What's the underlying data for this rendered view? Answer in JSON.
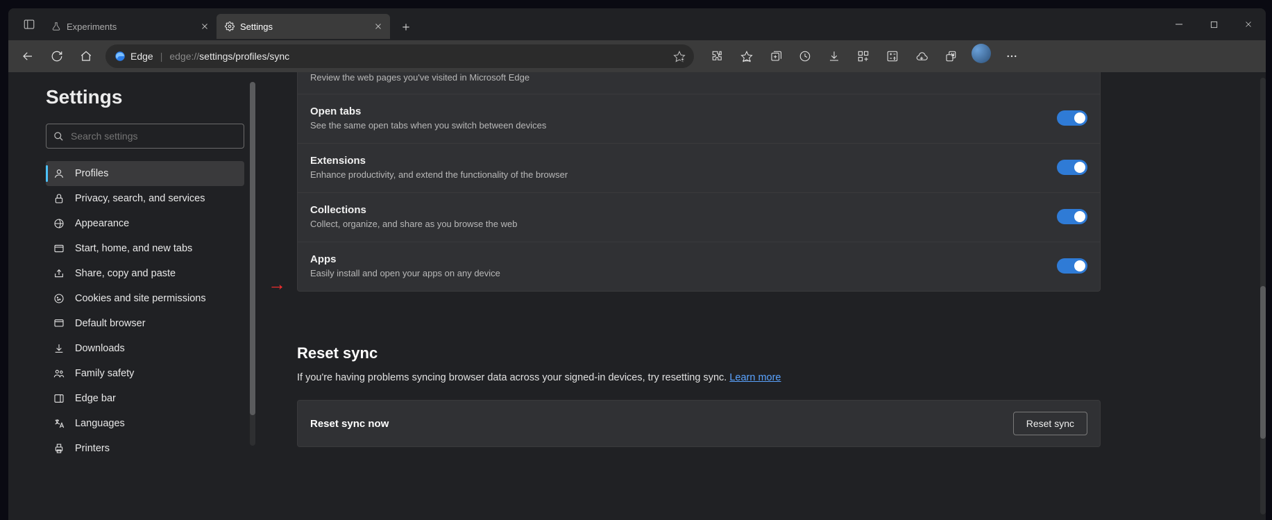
{
  "tabs": [
    {
      "label": "Experiments",
      "active": false
    },
    {
      "label": "Settings",
      "active": true
    }
  ],
  "address": {
    "brand": "Edge",
    "prefix": "edge://",
    "midpath": "settings/profiles/sync"
  },
  "sidebar": {
    "title": "Settings",
    "search_placeholder": "Search settings",
    "items": [
      {
        "label": "Profiles",
        "active": true
      },
      {
        "label": "Privacy, search, and services"
      },
      {
        "label": "Appearance"
      },
      {
        "label": "Start, home, and new tabs"
      },
      {
        "label": "Share, copy and paste"
      },
      {
        "label": "Cookies and site permissions"
      },
      {
        "label": "Default browser"
      },
      {
        "label": "Downloads"
      },
      {
        "label": "Family safety"
      },
      {
        "label": "Edge bar"
      },
      {
        "label": "Languages"
      },
      {
        "label": "Printers"
      }
    ]
  },
  "sync": {
    "history_sub": "Review the web pages you've visited in Microsoft Edge",
    "rows": [
      {
        "title": "Open tabs",
        "sub": "See the same open tabs when you switch between devices"
      },
      {
        "title": "Extensions",
        "sub": "Enhance productivity, and extend the functionality of the browser"
      },
      {
        "title": "Collections",
        "sub": "Collect, organize, and share as you browse the web"
      },
      {
        "title": "Apps",
        "sub": "Easily install and open your apps on any device"
      }
    ],
    "reset_heading": "Reset sync",
    "reset_desc": "If you're having problems syncing browser data across your signed-in devices, try resetting sync.",
    "learn_more": "Learn more",
    "reset_row_title": "Reset sync now",
    "reset_button": "Reset sync"
  }
}
